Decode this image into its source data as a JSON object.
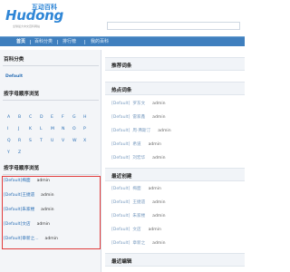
{
  "header": {
    "logo_text": "Hudong",
    "logo_cn": "互动百科",
    "logo_sub": "全球最大中文百科网站"
  },
  "nav": {
    "items": [
      {
        "label": "首页",
        "active": true
      },
      {
        "label": "百科分类",
        "active": false
      },
      {
        "label": "排行榜",
        "active": false
      },
      {
        "label": "我的百科",
        "active": false
      }
    ]
  },
  "left": {
    "category_title": "百科分类",
    "category_link": "Default",
    "alpha_title": "按字母顺序浏览",
    "alpha_rows": [
      [
        "A",
        "B",
        "C",
        "D",
        "E",
        "F",
        "G",
        "H"
      ],
      [
        "I",
        "J",
        "K",
        "L",
        "M",
        "N",
        "O",
        "P"
      ],
      [
        "Q",
        "R",
        "S",
        "T",
        "U",
        "V",
        "W",
        "X"
      ],
      [
        "Y",
        "Z"
      ]
    ],
    "alpha_title2": "按字母顺序浏览",
    "entries": [
      {
        "tag": "[Default]",
        "title": "梅面",
        "user": "admin"
      },
      {
        "tag": "[Default]",
        "title": "王捷遗",
        "user": "admin"
      },
      {
        "tag": "[Default]",
        "title": "朱家楼",
        "user": "admin"
      },
      {
        "tag": "[Default]",
        "title": "文店",
        "user": "admin"
      },
      {
        "tag": "[Default]",
        "title": "章新之...",
        "user": "admin"
      }
    ]
  },
  "right": {
    "recommend_title": "推荐词条",
    "hot_title": "热点词条",
    "hot": [
      {
        "tag": "[Default]",
        "title": "罗东文",
        "user": "admin"
      },
      {
        "tag": "[Default]",
        "title": "雷家鑫",
        "user": "admin"
      },
      {
        "tag": "[Default]",
        "title": "周·弗斯汀",
        "user": "admin"
      },
      {
        "tag": "[Default]",
        "title": "希道",
        "user": "admin"
      },
      {
        "tag": "[Default]",
        "title": "刘宏华",
        "user": "admin"
      }
    ],
    "recent_created_title": "最近创建",
    "recent_created": [
      {
        "tag": "[Default]",
        "title": "梅面",
        "user": "admin"
      },
      {
        "tag": "[Default]",
        "title": "王捷遗",
        "user": "admin"
      },
      {
        "tag": "[Default]",
        "title": "朱家楼",
        "user": "admin"
      },
      {
        "tag": "[Default]",
        "title": "文店",
        "user": "admin"
      },
      {
        "tag": "[Default]",
        "title": "章新之",
        "user": "admin"
      }
    ],
    "recent_edited_title": "最近编辑"
  },
  "colors": {
    "nav_bg": "#3f7fbe",
    "link": "#2b6fb5",
    "highlight_border": "#e23b3b"
  }
}
